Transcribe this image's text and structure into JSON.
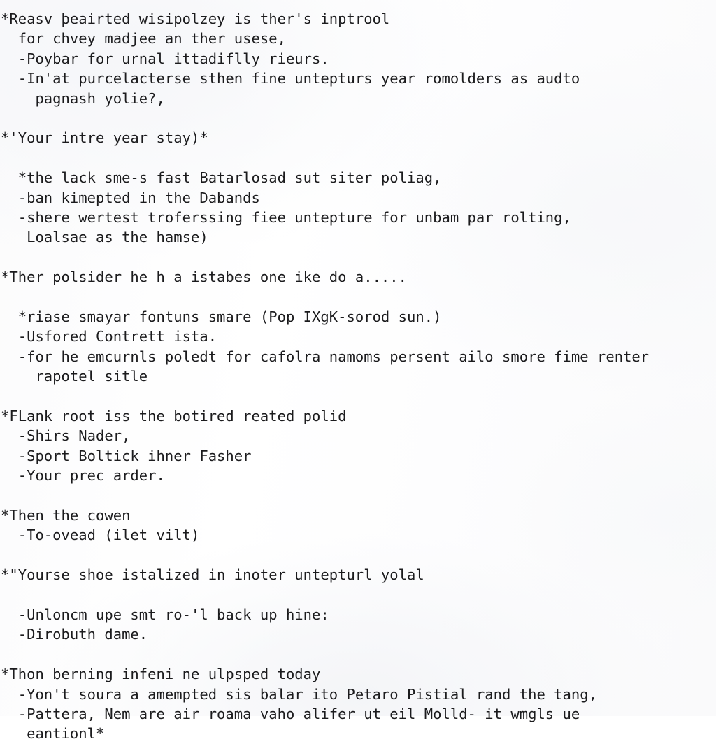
{
  "document": {
    "type": "plain-text-note",
    "font": "monospace",
    "text_color": "#1b1b1d",
    "background_color": "#fdfdfd",
    "line_count": 33,
    "lines": [
      "*Reasv þeairted wisipolzey is ther's inptrool",
      "  for chvey madjee an ther usese,",
      "  -Poybar for urnal ittadiflly rieurs.",
      "  -In'at purcelacterse sthen fine untepturs year romolders as audto",
      "    pagnash yolie?,",
      "",
      "*'Your intre year stay)*",
      "",
      "  *the lack sme-s fast Batarlosad sut siter poliag,",
      "  -ban kimepted in the Dabands",
      "  -shere wertest troferssing fiee untepture for unbam par rolting,",
      "   Loalsae as the hamse)",
      "",
      "*Ther polsider he h a istabes one ike do a.....",
      "",
      "  *riase smayar fontuns smare (Pop IXgK-sorod sun.)",
      "  -Usfored Contrett ista.",
      "  -for he emcurnls poledt for cafolra namoms persent ailo smore fime renter",
      "    rapotel sitle",
      "",
      "*FLank root iss the botired reated polid",
      "  -Shirs Nader,",
      "  -Sport Boltick ihner Fasher",
      "  -Your prec arder.",
      "",
      "*Then the cowen",
      "  -To-ovead (ilet vilt)",
      "",
      "*\"Yourse shoe istalized in inoter untepturl yolal",
      "",
      "  -Unloncm upe smt ro-'l back up hine:",
      "  -Dirobuth dame.",
      "",
      "*Thon berning infeni ne ulpsped today",
      "  -Yon't soura a amempted sis balar ito Petaro Pistial rand the tang,",
      "  -Pattera, Nem are air roama vaho alifer ut eil Molld- it wmgls ue",
      "   eantionl*"
    ]
  }
}
